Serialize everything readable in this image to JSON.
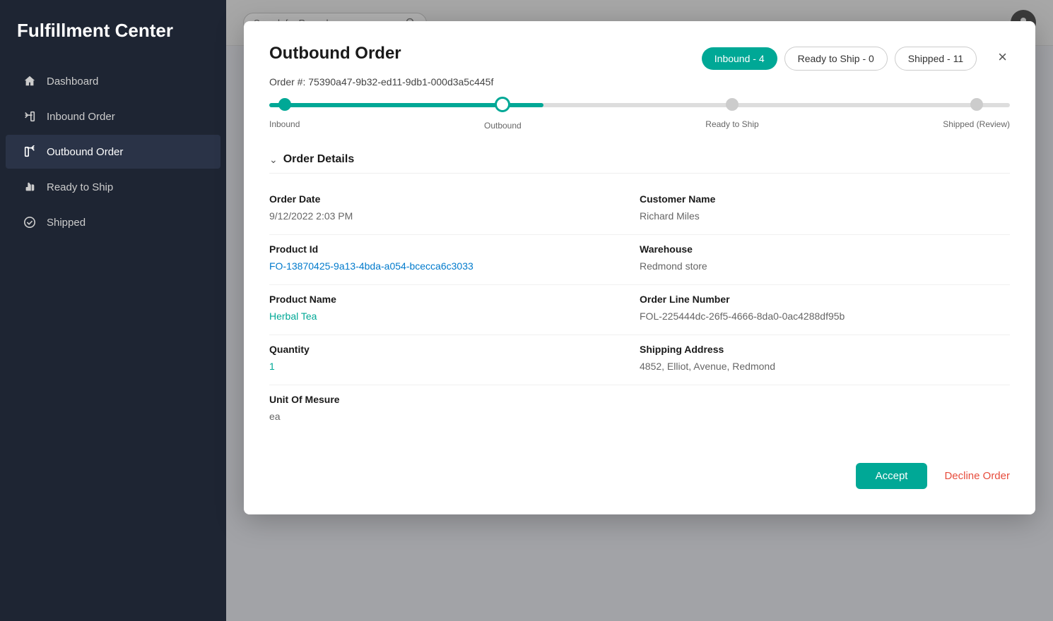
{
  "sidebar": {
    "title": "Fulfillment Center",
    "items": [
      {
        "id": "dashboard",
        "label": "Dashboard",
        "icon": "home",
        "active": false
      },
      {
        "id": "inbound-order",
        "label": "Inbound Order",
        "icon": "inbound",
        "active": false
      },
      {
        "id": "outbound-order",
        "label": "Outbound Order",
        "icon": "outbound",
        "active": true
      },
      {
        "id": "ready-to-ship",
        "label": "Ready to Ship",
        "icon": "thumb",
        "active": false
      },
      {
        "id": "shipped",
        "label": "Shipped",
        "icon": "check",
        "active": false
      }
    ]
  },
  "topbar": {
    "search_placeholder": "Search for Records"
  },
  "modal": {
    "title": "Outbound Order",
    "close_label": "×",
    "order_number_label": "Order #:",
    "order_number": "75390a47-9b32-ed11-9db1-000d3a5c445f",
    "badges": [
      {
        "id": "inbound",
        "label": "Inbound - 4",
        "active": true
      },
      {
        "id": "ready-to-ship",
        "label": "Ready to Ship - 0",
        "active": false
      },
      {
        "id": "shipped",
        "label": "Shipped - 11",
        "active": false
      }
    ],
    "stepper": {
      "steps": [
        {
          "id": "inbound",
          "label": "Inbound",
          "state": "completed"
        },
        {
          "id": "outbound",
          "label": "Outbound",
          "state": "active"
        },
        {
          "id": "ready-to-ship",
          "label": "Ready to Ship",
          "state": "inactive"
        },
        {
          "id": "shipped-review",
          "label": "Shipped (Review)",
          "state": "inactive"
        }
      ]
    },
    "section_title": "Order Details",
    "fields": {
      "order_date_label": "Order Date",
      "order_date_value": "9/12/2022 2:03 PM",
      "customer_name_label": "Customer Name",
      "customer_name_value": "Richard Miles",
      "product_id_label": "Product Id",
      "product_id_value": "FO-13870425-9a13-4bda-a054-bcecca6c3033",
      "warehouse_label": "Warehouse",
      "warehouse_value": "Redmond store",
      "product_name_label": "Product Name",
      "product_name_value": "Herbal Tea",
      "order_line_number_label": "Order Line Number",
      "order_line_number_value": "FOL-225444dc-26f5-4666-8da0-0ac4288df95b",
      "quantity_label": "Quantity",
      "quantity_value": "1",
      "shipping_address_label": "Shipping Address",
      "shipping_address_value": "4852, Elliot, Avenue, Redmond",
      "unit_of_measure_label": "Unit Of Mesure",
      "unit_of_measure_value": "ea"
    },
    "accept_label": "Accept",
    "decline_label": "Decline Order"
  }
}
